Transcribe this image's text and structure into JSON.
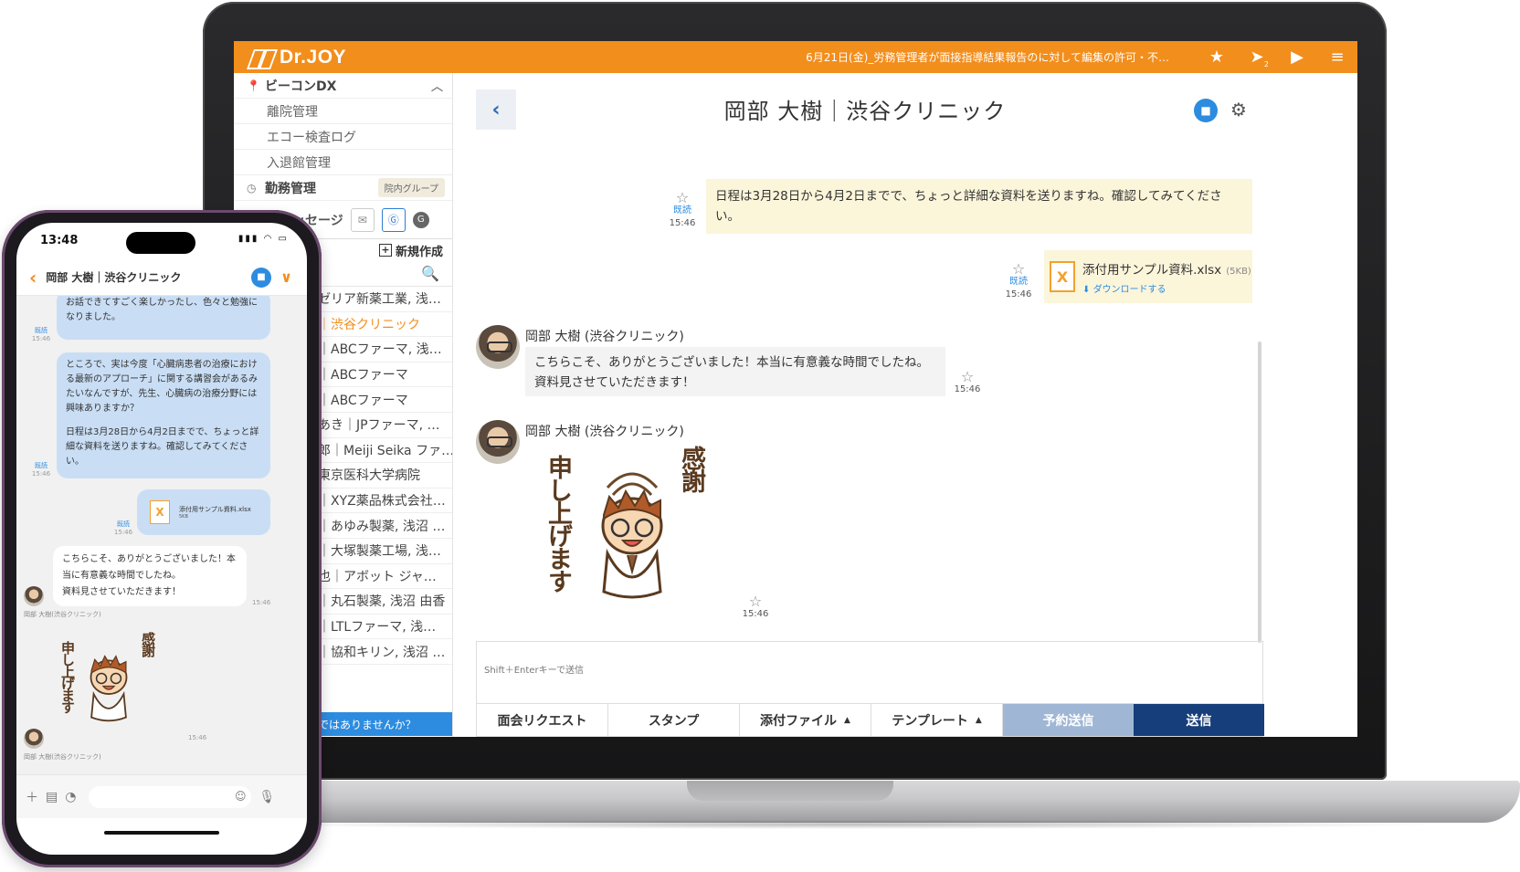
{
  "app": {
    "brand": "Dr.JOY",
    "notice": "6月21日(金)_労務管理者が面接指導結果報告のに対して編集の許可・不…",
    "top_icons": [
      "star-icon",
      "paper-plane-icon",
      "video-play-icon",
      "hamburger-menu-icon"
    ],
    "plane_badge": "2",
    "accent": "#f28e1c"
  },
  "sidebar": {
    "beacon_group": "ビーコンDX",
    "beacon_items": [
      "離院管理",
      "エコー検査ログ",
      "入退館管理"
    ],
    "work_group": "勤務管理",
    "work_badge": "院内グループ",
    "messages_label": "メッセージ",
    "new_label": "新規作成",
    "conversations": [
      "｜ゼリア新薬工業, 浅…",
      "樹｜渋谷クリニック",
      "作｜ABCファーマ, 浅…",
      "作｜ABCファーマ",
      "作｜ABCファーマ",
      "ちあき｜JPファーマ, …",
      "一郎｜Meiji Seika ファ…",
      "｜東京医科大学病院",
      "信｜XYZ薬品株式会社…",
      "義｜あゆみ製薬, 浅沼 …",
      "雅｜大塚製薬工場, 浅…",
      "慎也｜アボット ジャ…",
      "和｜丸石製薬, 浅沼 由香",
      "司｜LTLファーマ, 浅…",
      "壽｜協和キリン, 浅沼 …"
    ],
    "active_conversation": 1,
    "banner": "りではありませんか？"
  },
  "chat": {
    "title": "岡部 大樹｜渋谷クリニック",
    "read_label": "既読",
    "messages": {
      "out1_text": "日程は3月28日から4月2日までで、ちょっと詳細な資料を送りますね。確認してみてください。",
      "out1_time": "15:46",
      "file_name": "添付用サンプル資料.xlsx",
      "file_size": "(5KB)",
      "file_download": "ダウンロードする",
      "file_time": "15:46",
      "sender": "岡部 大樹 (渋谷クリニック)",
      "in1_line1": "こちらこそ、ありがとうございました！本当に有意義な時間でしたね。",
      "in1_line2": "資料見させていただきます！",
      "in1_time": "15:46",
      "sticker_time": "15:46"
    },
    "composer_hint": "Shift＋Enterキーで送信",
    "buttons": {
      "meeting": "面会リクエスト",
      "stamp": "スタンプ",
      "attach": "添付ファイル",
      "template": "テンプレート",
      "schedule": "予約送信",
      "send": "送信"
    }
  },
  "sticker": {
    "left_text": "申し上げます",
    "right_text": "感謝"
  },
  "phone": {
    "time": "13:48",
    "title": "岡部 大樹｜渋谷クリニック",
    "read_label": "既読",
    "time_label": "15:46",
    "bubble1": "お話できてすごく楽しかったし、色々と勉強になりました。",
    "bubble2a": "ところで、実は今度「心臓病患者の治療における最新のアプローチ」に関する講習会があるみたいなんですが、先生、心臓病の治療分野には興味ありますか？",
    "bubble2b": "日程は3月28日から4月2日までで、ちょっと詳細な資料を送りますね。確認してみてください。",
    "file_name": "添付用サンプル資料.xlsx",
    "file_size": "5KB",
    "reply": "こちらこそ、ありがとうございました！本当に有意義な時間でしたね。",
    "reply2": "資料見させていただきます！",
    "sender": "岡部 大樹(渋谷クリニック)"
  }
}
